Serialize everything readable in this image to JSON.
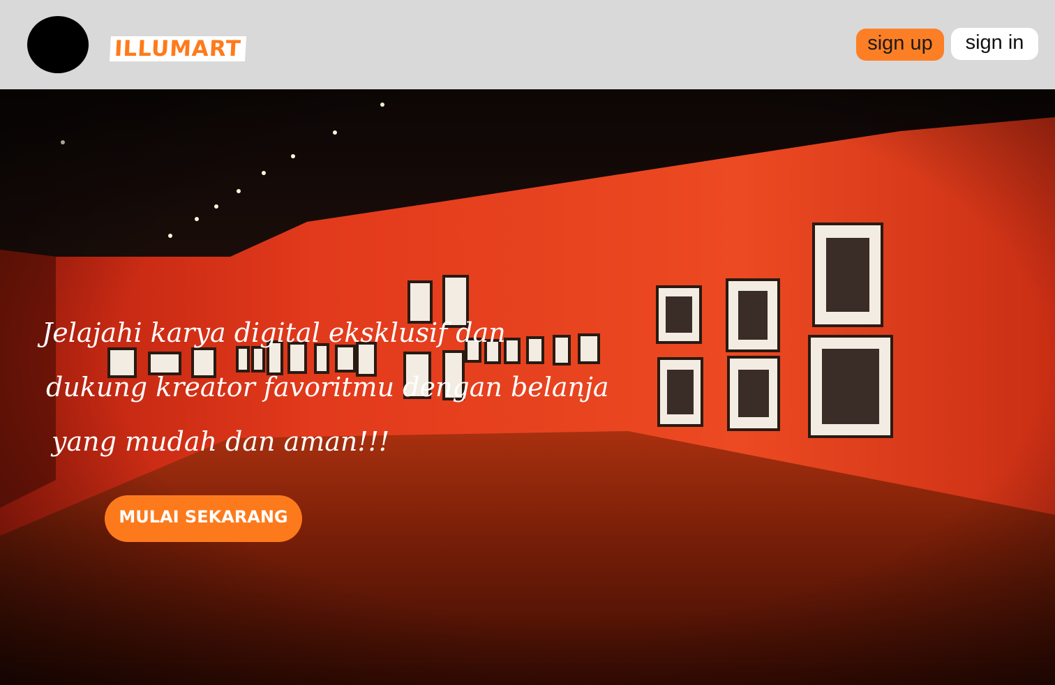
{
  "header": {
    "brand": "ILLUMART",
    "signup_label": "sign up",
    "signin_label": "sign in"
  },
  "hero": {
    "lines": [
      "Jelajahi karya digital eksklusif dan",
      "dukung kreator favoritmu dengan belanja",
      "yang mudah dan aman!!!"
    ],
    "cta_label": "MULAI SEKARANG"
  },
  "colors": {
    "header_bg": "#d9d9d9",
    "accent": "#fd7f25",
    "wall": "#e8361a"
  }
}
